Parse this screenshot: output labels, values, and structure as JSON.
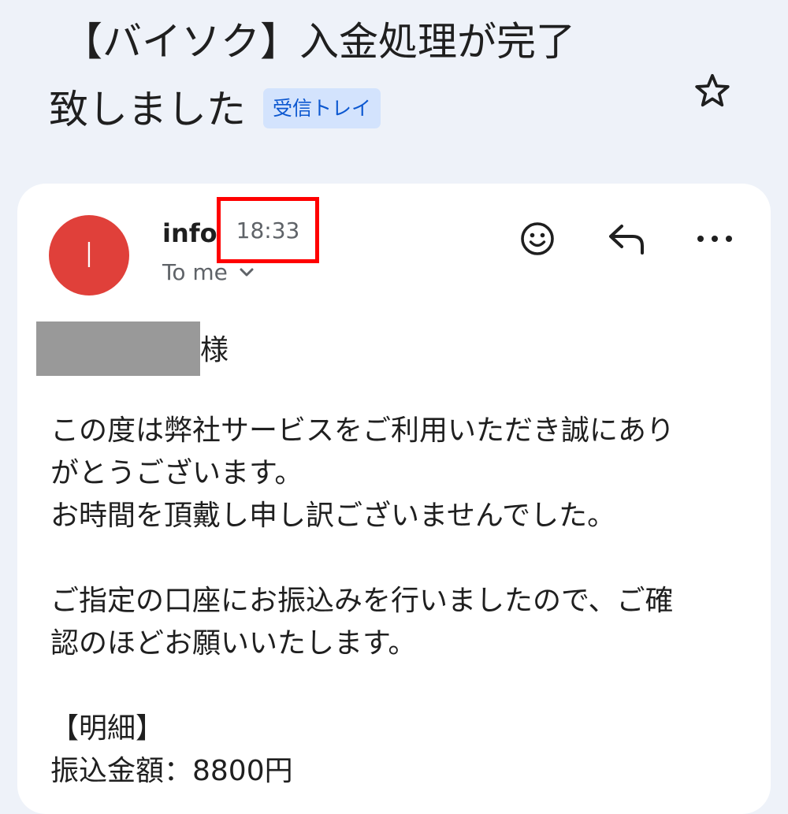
{
  "subject": {
    "line1": "【バイソク】入金処理が完了",
    "line2": "致しました",
    "label": "受信トレイ"
  },
  "icons": {
    "star": "star-icon",
    "emoji": "emoji-reaction-icon",
    "reply": "reply-icon",
    "more": "more-vert-icon",
    "chevron": "chevron-down-icon"
  },
  "message": {
    "avatar_letter": "I",
    "avatar_color": "#e0403a",
    "sender": "info",
    "time": "18:33",
    "recipient": "To me",
    "salutation_suffix": "様",
    "body": {
      "p1_line1": "この度は弊社サービスをご利用いただき誠にあり",
      "p1_line2": "がとうございます。",
      "p1_line3": "お時間を頂戴し申し訳ございませんでした。",
      "p2_line1": "ご指定の口座にお振込みを行いましたので、ご確",
      "p2_line2": "認のほどお願いいたします。",
      "detail_heading": "【明細】",
      "amount_line": "振込金額：8800円"
    }
  },
  "colors": {
    "background": "#eef2f9",
    "label_bg": "#d3e3fd",
    "label_text": "#0b57d0",
    "highlight_border": "#ff0000"
  }
}
